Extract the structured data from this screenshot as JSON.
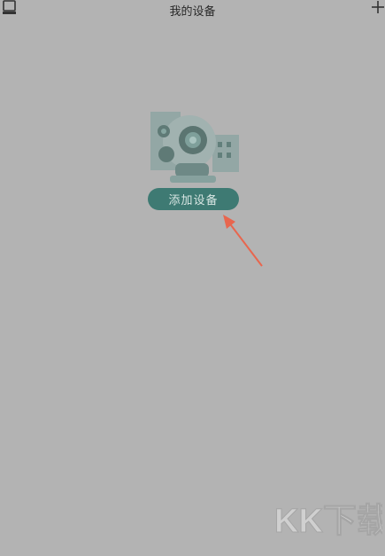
{
  "header": {
    "title": "我的设备",
    "left_icon": "device-list-icon",
    "right_icon": "plus-icon"
  },
  "main": {
    "illustration": "camera-building-illustration",
    "add_device_label": "添加设备",
    "accent_color": "#3e7a73",
    "annotation_arrow_color": "#e8664e"
  },
  "watermark": {
    "text": "KK下载"
  }
}
